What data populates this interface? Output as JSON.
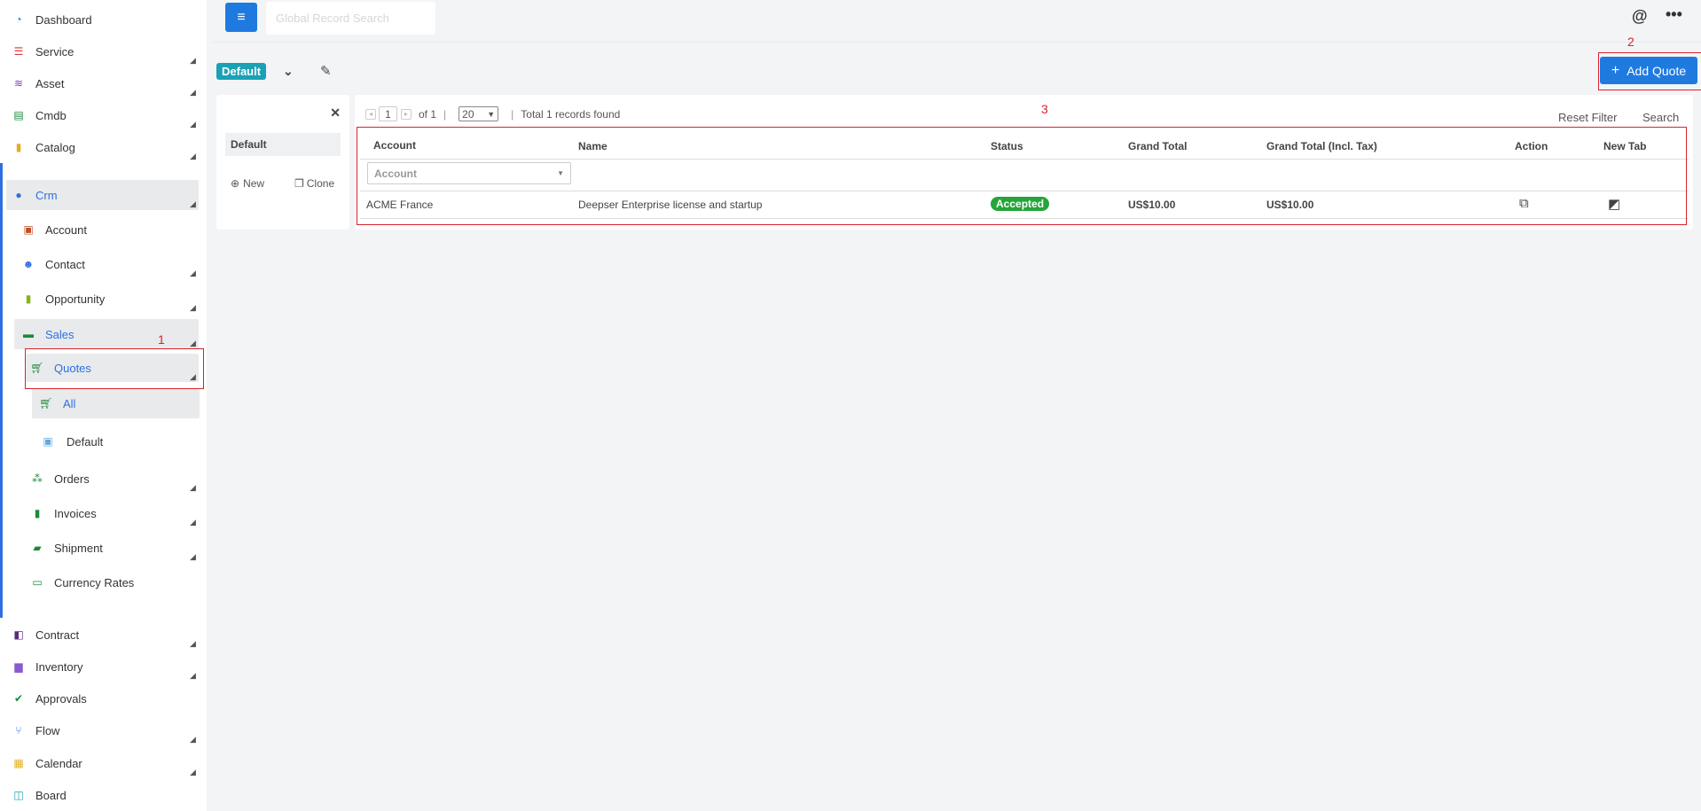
{
  "sidebar": {
    "items": [
      {
        "label": "Dashboard",
        "icon": "dashboard-icon",
        "color": "#2f6fe0"
      },
      {
        "label": "Service",
        "icon": "service-icon",
        "color": "#e03030"
      },
      {
        "label": "Asset",
        "icon": "wifi-icon",
        "color": "#7b3fb0"
      },
      {
        "label": "Cmdb",
        "icon": "database-icon",
        "color": "#1a8a3a"
      },
      {
        "label": "Catalog",
        "icon": "clipboard-icon",
        "color": "#e0b020"
      },
      {
        "label": "Crm",
        "icon": "user-icon",
        "color": "#2f6fe0"
      },
      {
        "label": "Account",
        "icon": "building-icon",
        "color": "#c0502a"
      },
      {
        "label": "Contact",
        "icon": "users-icon",
        "color": "#2f6fe0"
      },
      {
        "label": "Opportunity",
        "icon": "file-icon",
        "color": "#8ab020"
      },
      {
        "label": "Sales",
        "icon": "store-icon",
        "color": "#1a8a3a"
      },
      {
        "label": "Quotes",
        "icon": "cart-icon",
        "color": "#1a8a3a"
      },
      {
        "label": "All",
        "icon": "cart-icon",
        "color": "#1a8a3a"
      },
      {
        "label": "Default",
        "icon": "monitor-icon",
        "color": "#60a8e0"
      },
      {
        "label": "Orders",
        "icon": "cubes-icon",
        "color": "#1a8a3a"
      },
      {
        "label": "Invoices",
        "icon": "invoice-icon",
        "color": "#1a8a3a"
      },
      {
        "label": "Shipment",
        "icon": "truck-icon",
        "color": "#1a8a3a"
      },
      {
        "label": "Currency Rates",
        "icon": "money-icon",
        "color": "#1a8a3a"
      },
      {
        "label": "Contract",
        "icon": "scroll-icon",
        "color": "#5a2a80"
      },
      {
        "label": "Inventory",
        "icon": "warehouse-icon",
        "color": "#8a5ad0"
      },
      {
        "label": "Approvals",
        "icon": "check-circle-icon",
        "color": "#1a8a3a"
      },
      {
        "label": "Flow",
        "icon": "branch-icon",
        "color": "#2f6fe0"
      },
      {
        "label": "Calendar",
        "icon": "calendar-icon",
        "color": "#e0b020"
      },
      {
        "label": "Board",
        "icon": "board-icon",
        "color": "#1ba1b5"
      }
    ]
  },
  "annotations": {
    "one": "1",
    "two": "2",
    "three": "3"
  },
  "topbar": {
    "search_placeholder": "Global Record Search"
  },
  "view": {
    "badge": "Default"
  },
  "add_quote_label": "Add Quote",
  "filter_panel": {
    "default_label": "Default",
    "new_label": "New",
    "clone_label": "Clone"
  },
  "pagination": {
    "page": "1",
    "of": "of 1",
    "page_size": "20",
    "total": "Total 1 records found"
  },
  "actions": {
    "reset_filter": "Reset Filter",
    "search": "Search"
  },
  "table": {
    "columns": [
      "Account",
      "Name",
      "Status",
      "Grand Total",
      "Grand Total (Incl. Tax)",
      "Action",
      "New Tab"
    ],
    "filter_placeholder": "Account",
    "rows": [
      {
        "account": "ACME France",
        "name": "Deepser Enterprise license and startup",
        "status": "Accepted",
        "grand_total": "US$10.00",
        "grand_total_tax": "US$10.00"
      }
    ]
  },
  "colors": {
    "accent": "#1f7ae0",
    "badge": "#1ba1b5",
    "status_accepted": "#25a43a",
    "annotation": "#d9232b"
  }
}
